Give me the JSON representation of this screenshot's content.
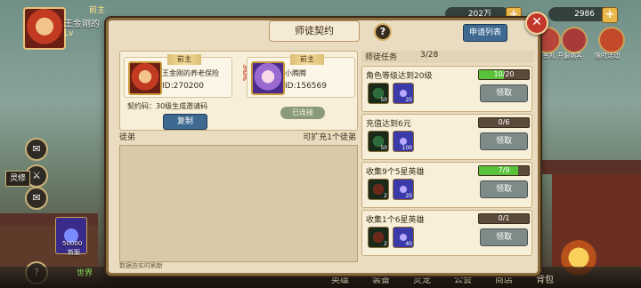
{
  "hero": {
    "name": "王金刚的",
    "level": "Lv",
    "rank": "前主"
  },
  "currency": [
    {
      "value": "202万"
    },
    {
      "value": "2986"
    }
  ],
  "right_icons": [
    {
      "label": "分享有礼"
    },
    {
      "label": "开服纳客"
    },
    {
      "label": "限时活动"
    }
  ],
  "left_buttons": [
    {
      "label": "灵修"
    }
  ],
  "left_event": {
    "label": "50000",
    "sublabel": "新服"
  },
  "bottom_nav": [
    "英雄",
    "装备",
    "灵宠",
    "公会",
    "商店",
    "背包"
  ],
  "world_chat": "世界",
  "dialog": {
    "title": "师徒契约",
    "help": "?",
    "apply_button": "申请列表",
    "close": "✕",
    "contract": {
      "master": {
        "tag": "前主",
        "name": "王金刚的养老保险",
        "id": "ID:270200"
      },
      "disciple": {
        "tag": "前主",
        "name": "小腾腾",
        "id": "ID:156569"
      },
      "code_label": "契约码：30级生成邀请码",
      "copy_button": "复制",
      "connected": "已连接"
    },
    "disciples": {
      "label": "徒弟",
      "right_label": "可扩充1个徒弟",
      "footer": "数据由实时刷新"
    },
    "tasks": {
      "label": "师徒任务",
      "count": "3/28",
      "items": [
        {
          "title": "角色等级达到20级",
          "progress": "10/20",
          "fraction": 0.5,
          "claim": "领取",
          "rewards": [
            {
              "icon": "jade-icon",
              "num": "50",
              "color": "#2e6b3a"
            },
            {
              "icon": "gem-icon",
              "num": "20",
              "color": "#3a3aa8"
            }
          ]
        },
        {
          "title": "充值达到6元",
          "progress": "0/6",
          "fraction": 0.0,
          "claim": "领取",
          "rewards": [
            {
              "icon": "jade-icon",
              "num": "50",
              "color": "#2e6b3a"
            },
            {
              "icon": "gem-icon",
              "num": "100",
              "color": "#3a3aa8"
            }
          ]
        },
        {
          "title": "收集9个5星英雄",
          "progress": "7/9",
          "fraction": 0.78,
          "claim": "领取",
          "rewards": [
            {
              "icon": "staff-icon",
              "num": "2",
              "color": "#6a2a1a"
            },
            {
              "icon": "gem-icon",
              "num": "20",
              "color": "#3a3aa8"
            }
          ]
        },
        {
          "title": "收集1个6星英雄",
          "progress": "0/1",
          "fraction": 0.0,
          "claim": "领取",
          "rewards": [
            {
              "icon": "staff-icon",
              "num": "2",
              "color": "#6a2a1a"
            },
            {
              "icon": "gem-icon",
              "num": "40",
              "color": "#3a3aa8"
            }
          ]
        }
      ]
    }
  }
}
